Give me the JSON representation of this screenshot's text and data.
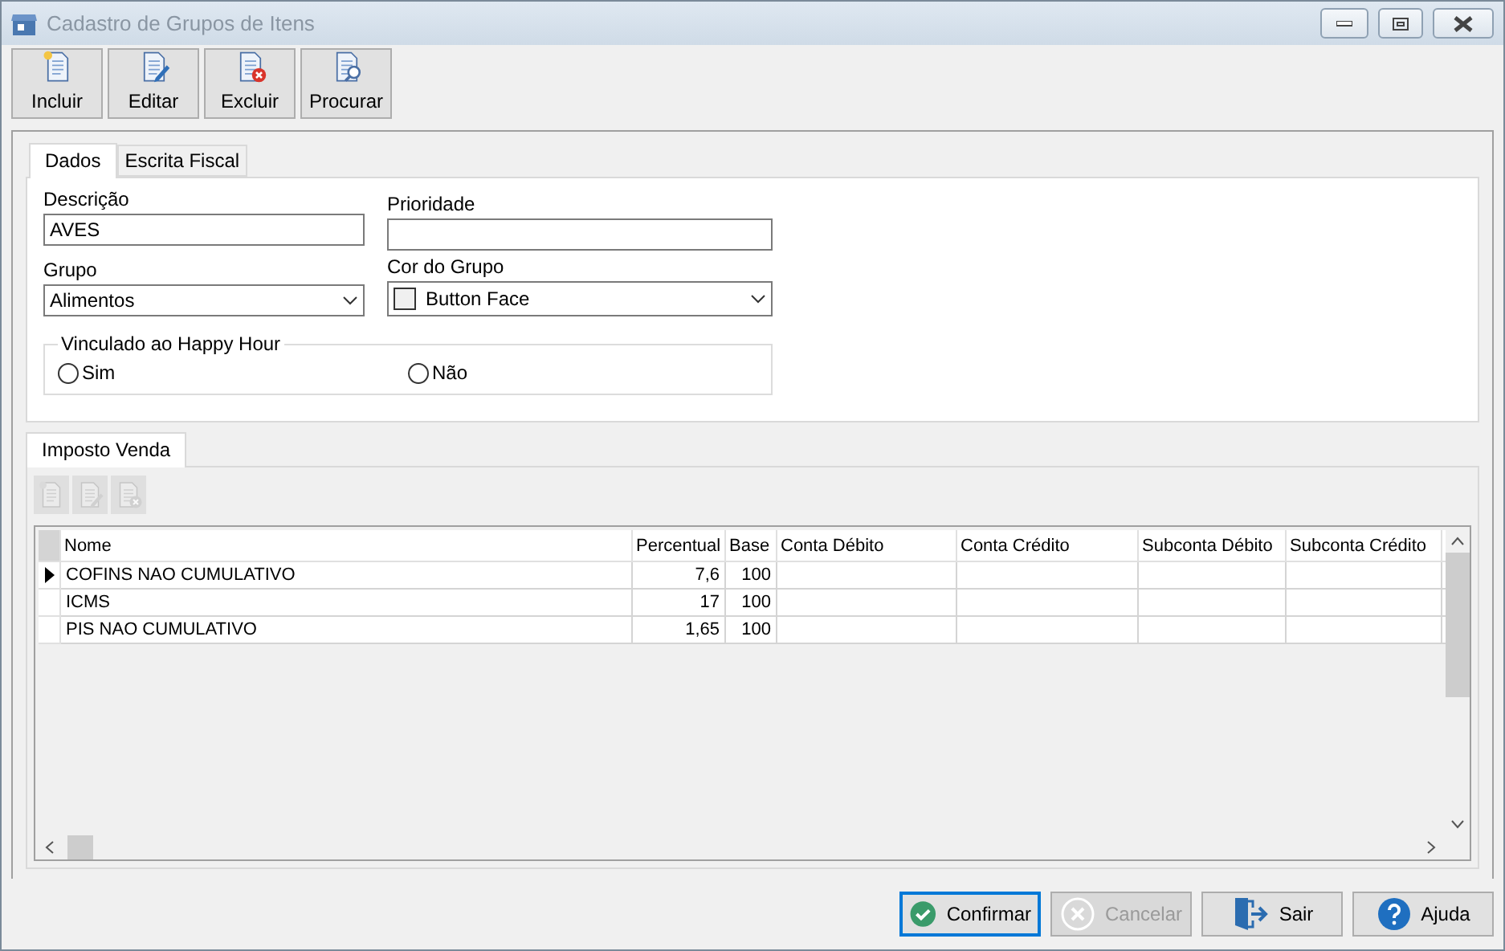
{
  "window": {
    "title": "Cadastro de Grupos de Itens"
  },
  "toolbar": [
    {
      "label": "Incluir",
      "kind": "new"
    },
    {
      "label": "Editar",
      "kind": "edit"
    },
    {
      "label": "Excluir",
      "kind": "delete"
    },
    {
      "label": "Procurar",
      "kind": "search"
    }
  ],
  "tabs": [
    {
      "label": "Dados",
      "selected": true
    },
    {
      "label": "Escrita Fiscal",
      "selected": false
    }
  ],
  "form": {
    "descricao": {
      "label": "Descrição",
      "value": "AVES"
    },
    "prioridade": {
      "label": "Prioridade"
    },
    "grupo": {
      "label": "Grupo",
      "value": "Alimentos"
    },
    "cor": {
      "label": "Cor do Grupo",
      "value": "Button Face",
      "color": "#f0f0f0"
    },
    "happy_hour": {
      "label": "Vinculado ao Happy Hour",
      "options": [
        {
          "label": "Sim",
          "selected": false
        },
        {
          "label": "Não",
          "selected": false
        }
      ]
    }
  },
  "sub_tabs": [
    {
      "label": "Imposto Venda",
      "selected": true
    }
  ],
  "grid_tools": [
    {
      "kind": "new",
      "disabled": true
    },
    {
      "kind": "edit",
      "disabled": true
    },
    {
      "kind": "delete",
      "disabled": true
    }
  ],
  "table": {
    "columns": [
      {
        "label": "Nome",
        "kind": "text"
      },
      {
        "label": "Percentual",
        "kind": "number"
      },
      {
        "label": "Base",
        "kind": "number"
      },
      {
        "label": "Conta Débito",
        "kind": "text"
      },
      {
        "label": "Conta Crédito",
        "kind": "text"
      },
      {
        "label": "Subconta Débito",
        "kind": "text"
      },
      {
        "label": "Subconta Crédito",
        "kind": "text"
      }
    ],
    "rows": [
      {
        "cells": [
          "COFINS NAO CUMULATIVO",
          "7,6",
          "100"
        ],
        "current": true
      },
      {
        "cells": [
          "ICMS",
          "17",
          "100"
        ],
        "current": false
      },
      {
        "cells": [
          "PIS NAO CUMULATIVO",
          "1,65",
          "100"
        ],
        "current": false
      }
    ]
  },
  "buttons": [
    {
      "label": "Confirmar",
      "kind": "confirm",
      "disabled": false,
      "focused": true
    },
    {
      "label": "Cancelar",
      "kind": "cancel",
      "disabled": true,
      "focused": false
    },
    {
      "label": "Sair",
      "kind": "exit",
      "disabled": false,
      "focused": false
    },
    {
      "label": "Ajuda",
      "kind": "help",
      "disabled": false,
      "focused": false
    }
  ]
}
